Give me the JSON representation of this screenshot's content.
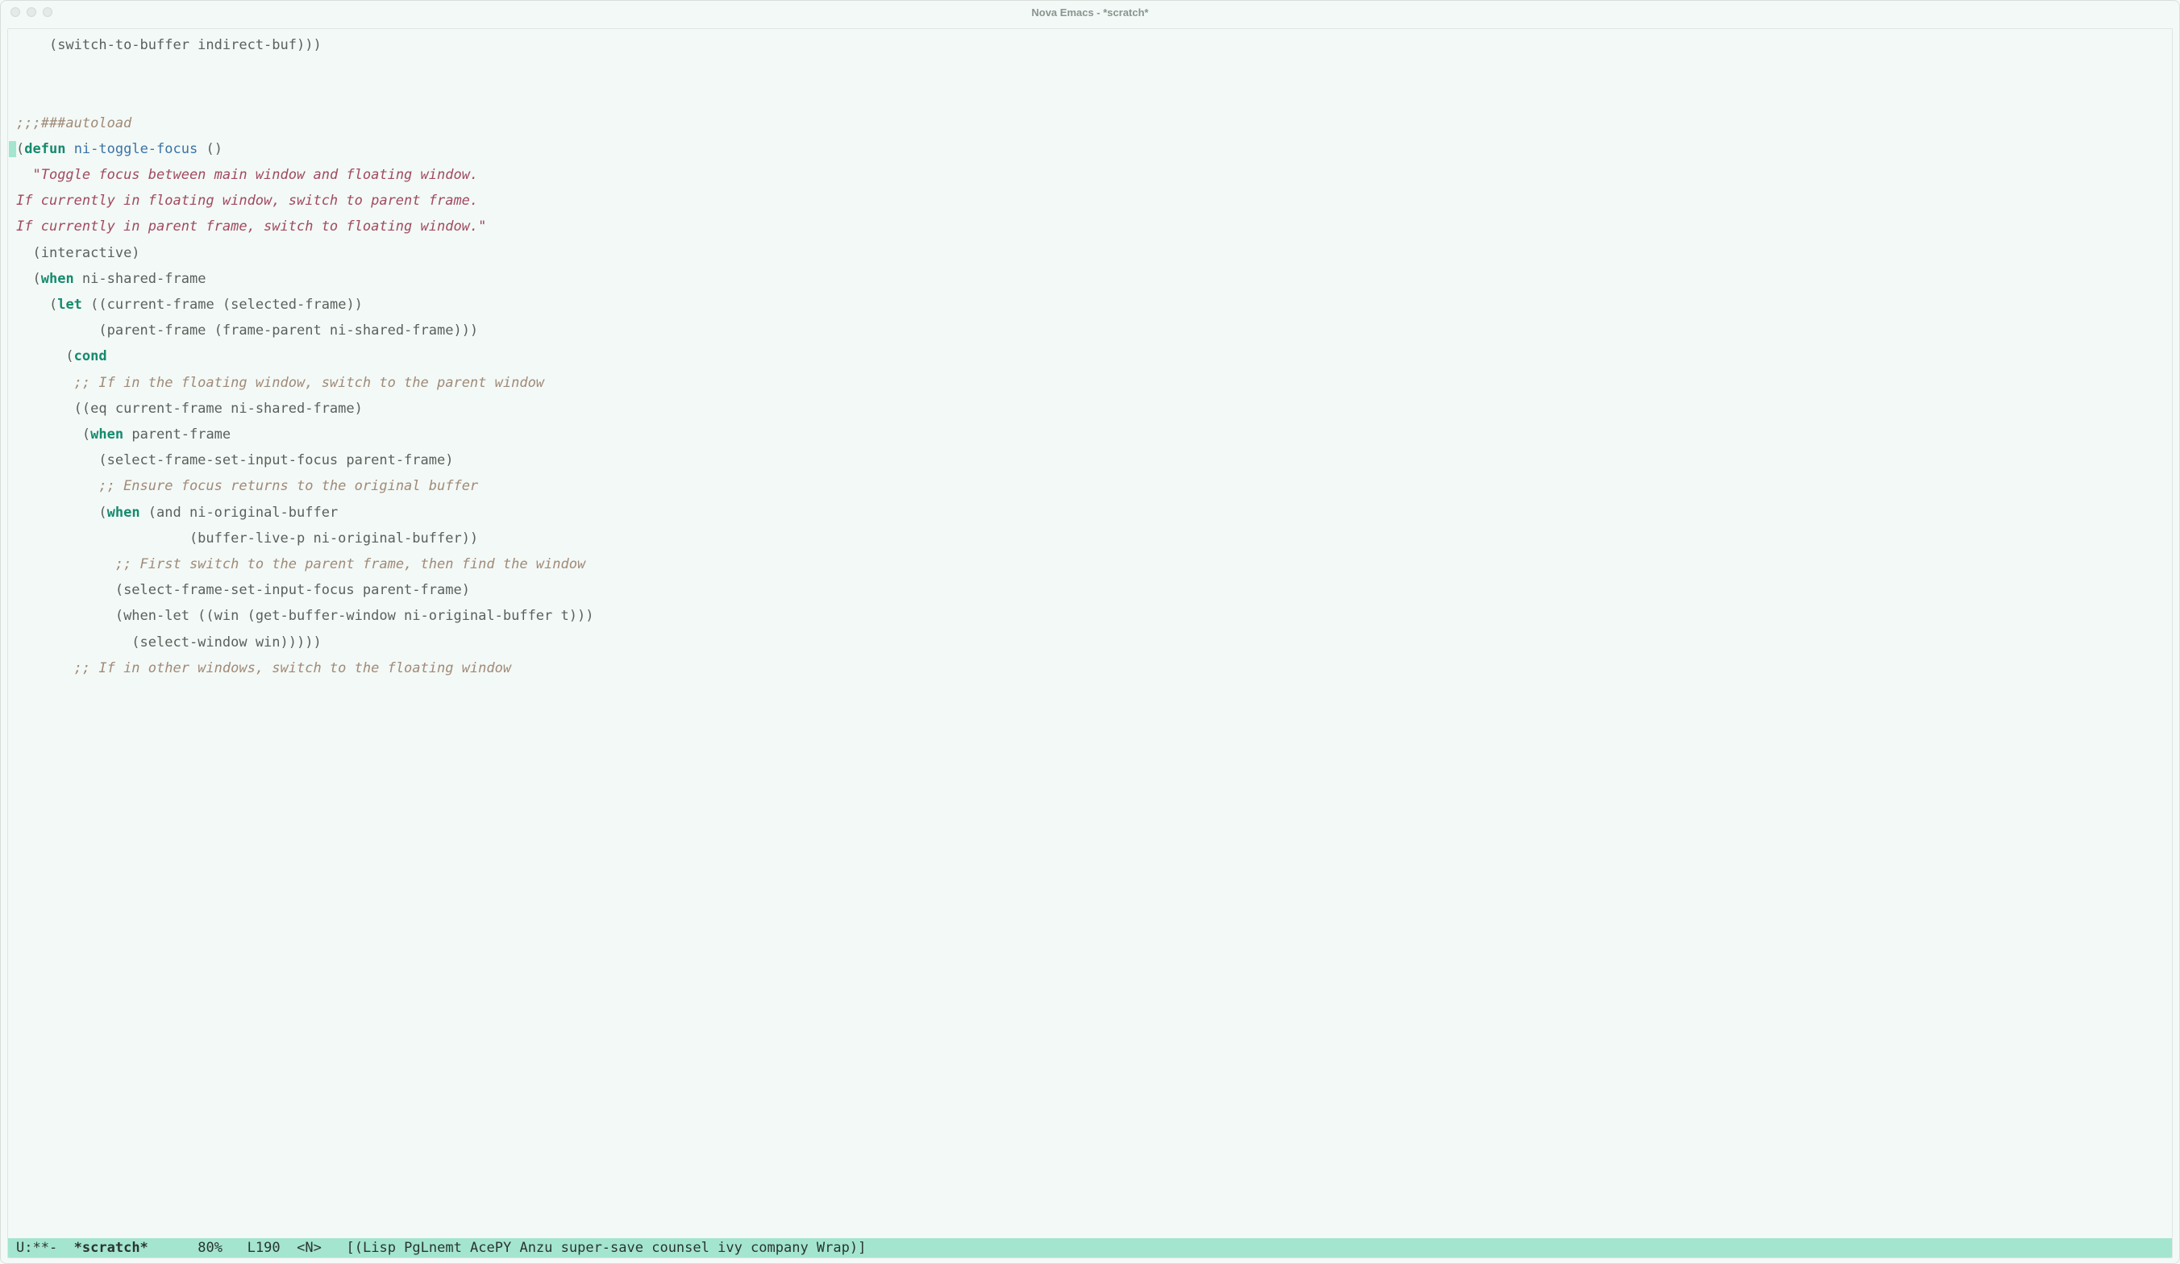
{
  "window": {
    "title": "Nova Emacs - *scratch*"
  },
  "code": {
    "lines": [
      {
        "indent": "    ",
        "tokens": [
          {
            "t": "plain",
            "v": "(switch-to-buffer indirect-buf)))"
          }
        ]
      },
      {
        "indent": "",
        "tokens": []
      },
      {
        "indent": "",
        "tokens": []
      },
      {
        "indent": "",
        "tokens": [
          {
            "t": "com",
            "v": ";;;###autoload"
          }
        ]
      },
      {
        "indent": "",
        "cursor_before": true,
        "tokens": [
          {
            "t": "plain",
            "v": "("
          },
          {
            "t": "kw",
            "v": "defun"
          },
          {
            "t": "plain",
            "v": " "
          },
          {
            "t": "fn",
            "v": "ni-toggle-focus"
          },
          {
            "t": "plain",
            "v": " ()"
          }
        ]
      },
      {
        "indent": "  ",
        "tokens": [
          {
            "t": "doc",
            "v": "\"Toggle focus between main window and floating window."
          }
        ]
      },
      {
        "indent": "",
        "tokens": [
          {
            "t": "doc",
            "v": "If currently in floating window, switch to parent frame."
          }
        ]
      },
      {
        "indent": "",
        "tokens": [
          {
            "t": "doc",
            "v": "If currently in parent frame, switch to floating window.\""
          }
        ]
      },
      {
        "indent": "  ",
        "tokens": [
          {
            "t": "plain",
            "v": "(interactive)"
          }
        ]
      },
      {
        "indent": "  ",
        "tokens": [
          {
            "t": "plain",
            "v": "("
          },
          {
            "t": "kw",
            "v": "when"
          },
          {
            "t": "plain",
            "v": " ni-shared-frame"
          }
        ]
      },
      {
        "indent": "    ",
        "tokens": [
          {
            "t": "plain",
            "v": "("
          },
          {
            "t": "kw",
            "v": "let"
          },
          {
            "t": "plain",
            "v": " ((current-frame (selected-frame))"
          }
        ]
      },
      {
        "indent": "          ",
        "tokens": [
          {
            "t": "plain",
            "v": "(parent-frame (frame-parent ni-shared-frame)))"
          }
        ]
      },
      {
        "indent": "      ",
        "tokens": [
          {
            "t": "plain",
            "v": "("
          },
          {
            "t": "kw",
            "v": "cond"
          }
        ]
      },
      {
        "indent": "       ",
        "tokens": [
          {
            "t": "com",
            "v": ";; If in the floating window, switch to the parent window"
          }
        ]
      },
      {
        "indent": "       ",
        "tokens": [
          {
            "t": "plain",
            "v": "((eq current-frame ni-shared-frame)"
          }
        ]
      },
      {
        "indent": "        ",
        "tokens": [
          {
            "t": "plain",
            "v": "("
          },
          {
            "t": "kw",
            "v": "when"
          },
          {
            "t": "plain",
            "v": " parent-frame"
          }
        ]
      },
      {
        "indent": "          ",
        "tokens": [
          {
            "t": "plain",
            "v": "(select-frame-set-input-focus parent-frame)"
          }
        ]
      },
      {
        "indent": "          ",
        "tokens": [
          {
            "t": "com",
            "v": ";; Ensure focus returns to the original buffer"
          }
        ]
      },
      {
        "indent": "          ",
        "tokens": [
          {
            "t": "plain",
            "v": "("
          },
          {
            "t": "kw",
            "v": "when"
          },
          {
            "t": "plain",
            "v": " (and ni-original-buffer"
          }
        ]
      },
      {
        "indent": "                     ",
        "tokens": [
          {
            "t": "plain",
            "v": "(buffer-live-p ni-original-buffer))"
          }
        ]
      },
      {
        "indent": "            ",
        "tokens": [
          {
            "t": "com",
            "v": ";; First switch to the parent frame, then find the window"
          }
        ]
      },
      {
        "indent": "            ",
        "tokens": [
          {
            "t": "plain",
            "v": "(select-frame-set-input-focus parent-frame)"
          }
        ]
      },
      {
        "indent": "            ",
        "tokens": [
          {
            "t": "plain",
            "v": "(when-let ((win (get-buffer-window ni-original-buffer t)))"
          }
        ]
      },
      {
        "indent": "              ",
        "tokens": [
          {
            "t": "plain",
            "v": "(select-window win)))))"
          }
        ]
      },
      {
        "indent": "       ",
        "tokens": [
          {
            "t": "com",
            "v": ";; If in other windows, switch to the floating window"
          }
        ]
      }
    ]
  },
  "modeline": {
    "status": "U:**-",
    "buffer": "*scratch*",
    "percent": "80%",
    "line": "L190",
    "mode_indicator": "<N>",
    "modes": "[(Lisp PgLnemt AcePY Anzu super-save counsel ivy company Wrap)]"
  }
}
